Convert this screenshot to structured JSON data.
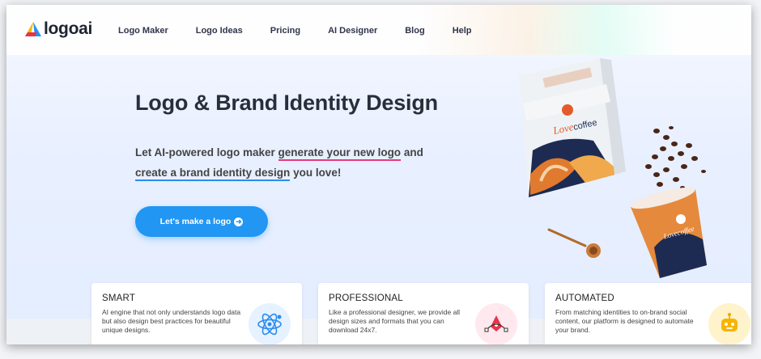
{
  "brand": {
    "logo_text": "logoai",
    "accent": "#2196f3"
  },
  "nav": {
    "items": [
      {
        "label": "Logo Maker"
      },
      {
        "label": "Logo Ideas"
      },
      {
        "label": "Pricing"
      },
      {
        "label": "AI Designer"
      },
      {
        "label": "Blog"
      },
      {
        "label": "Help"
      }
    ]
  },
  "hero": {
    "title": "Logo & Brand Identity Design",
    "subtitle_part1": "Let AI-powered logo maker ",
    "subtitle_link1": "generate your new logo",
    "subtitle_part2": " and",
    "subtitle_link2": "create a brand identity design",
    "subtitle_part3": " you love!",
    "cta_label": "Let's make a logo"
  },
  "product_art": {
    "bag_brand": "Lovecoffee",
    "bag_brand_love": "Love",
    "bag_brand_coffee": "coffee",
    "cup_brand": "Lovecoffee"
  },
  "features": [
    {
      "title": "SMART",
      "text": "AI engine that not only understands logo data but also design best practices for beautiful unique designs.",
      "icon": "atom-icon",
      "icon_bg": "#e6f2ff"
    },
    {
      "title": "PROFESSIONAL",
      "text": "Like a professional designer, we provide all design sizes and formats that you can download 24x7.",
      "icon": "pen-tool-icon",
      "icon_bg": "#ffe8ee"
    },
    {
      "title": "AUTOMATED",
      "text": "From matching identities to on-brand social content, our platform is designed to automate your brand.",
      "icon": "robot-icon",
      "icon_bg": "#fff3cc"
    }
  ]
}
